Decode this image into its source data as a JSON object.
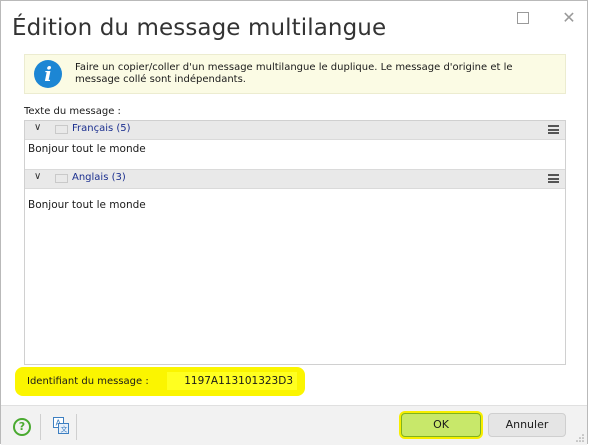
{
  "window": {
    "title": "Édition du message multilangue",
    "maximize_icon": "maximize-icon",
    "close_icon": "close-icon",
    "close_glyph": "✕"
  },
  "info": {
    "icon": "info-icon",
    "icon_glyph": "i",
    "text": "Faire un copier/coller d'un message multilangue le duplique. Le message d'origine et le message collé sont indépendants."
  },
  "message": {
    "label": "Texte du message :",
    "languages": [
      {
        "name": "Français (5)",
        "flag": "flag-france-icon",
        "text": "Bonjour tout le monde"
      },
      {
        "name": "Anglais (3)",
        "flag": "flag-uk-icon",
        "text": "Bonjour tout le monde"
      }
    ]
  },
  "identifier": {
    "label": "Identifiant du message :",
    "value": "1197A113101323D3",
    "highlight_color": "#fbf500"
  },
  "footer": {
    "help_icon": "help-icon",
    "help_glyph": "?",
    "translate_icon": "translate-icon",
    "ok_label": "OK",
    "cancel_label": "Annuler",
    "ok_color": "#c8e86a"
  }
}
